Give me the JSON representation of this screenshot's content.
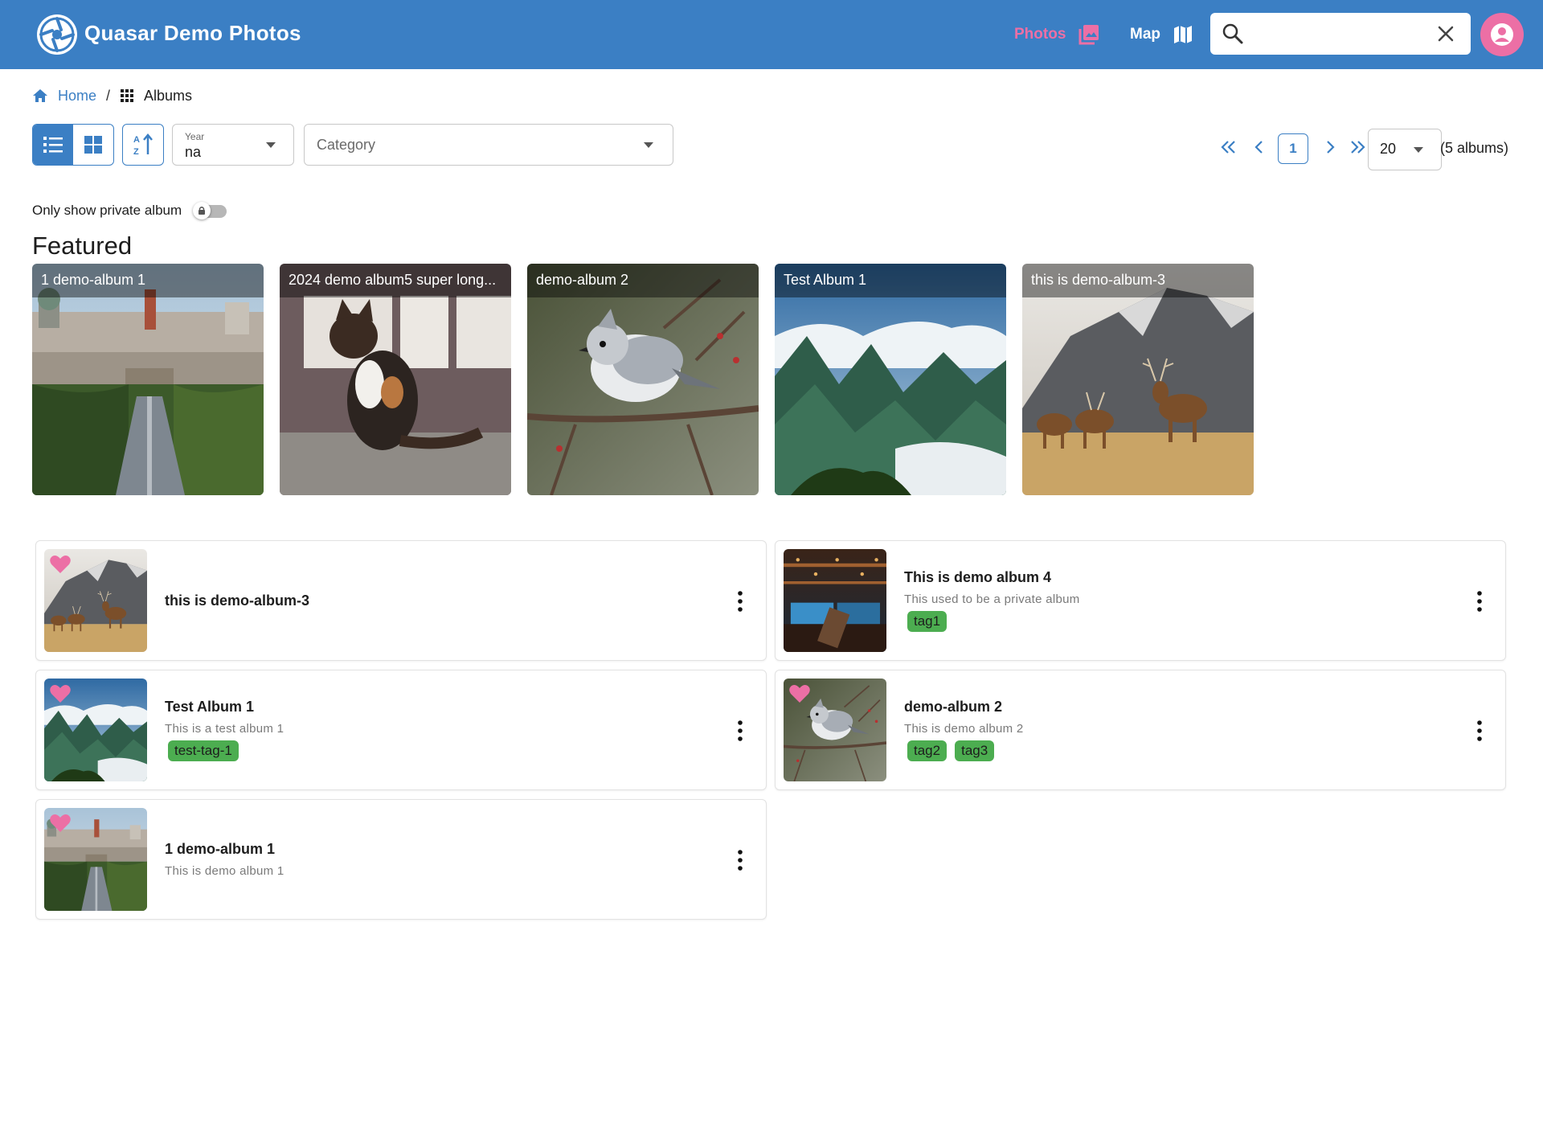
{
  "header": {
    "app_title": "Quasar Demo Photos",
    "nav_photos_label": "Photos",
    "nav_map_label": "Map",
    "search_value": "",
    "colors": {
      "bar": "#3b7fc4",
      "accent": "#ec6fa5"
    },
    "icons": [
      "app-logo-icon",
      "photos-icon",
      "map-icon",
      "search-icon",
      "close-icon",
      "account-icon"
    ]
  },
  "breadcrumb": {
    "home": "Home",
    "separator": "/",
    "current": "Albums"
  },
  "toolbar": {
    "year_label": "Year",
    "year_value": "na",
    "category_placeholder": "Category",
    "view_modes": [
      "list",
      "grid"
    ],
    "active_view": "list"
  },
  "pagination": {
    "current_page": "1",
    "per_page": "20",
    "total_text": "(5 albums)"
  },
  "filters": {
    "private_label": "Only show private album",
    "private_enabled": false
  },
  "featured": {
    "heading": "Featured",
    "albums": [
      {
        "title": "1 demo-album 1"
      },
      {
        "title": "2024 demo album5 super long..."
      },
      {
        "title": "demo-album 2"
      },
      {
        "title": "Test Album 1"
      },
      {
        "title": "this is demo-album-3"
      }
    ]
  },
  "albums": [
    {
      "title": "this is demo-album-3",
      "description": "",
      "tags": [],
      "favorite": true
    },
    {
      "title": "This is demo album 4",
      "description": "This used to be a private album",
      "tags": [
        "tag1"
      ],
      "favorite": false
    },
    {
      "title": "Test Album 1",
      "description": "This is a test album 1",
      "tags": [
        "test-tag-1"
      ],
      "favorite": true
    },
    {
      "title": "demo-album 2",
      "description": "This is demo album 2",
      "tags": [
        "tag2",
        "tag3"
      ],
      "favorite": true
    },
    {
      "title": "1 demo-album 1",
      "description": "This is demo album 1",
      "tags": [],
      "favorite": true
    }
  ]
}
